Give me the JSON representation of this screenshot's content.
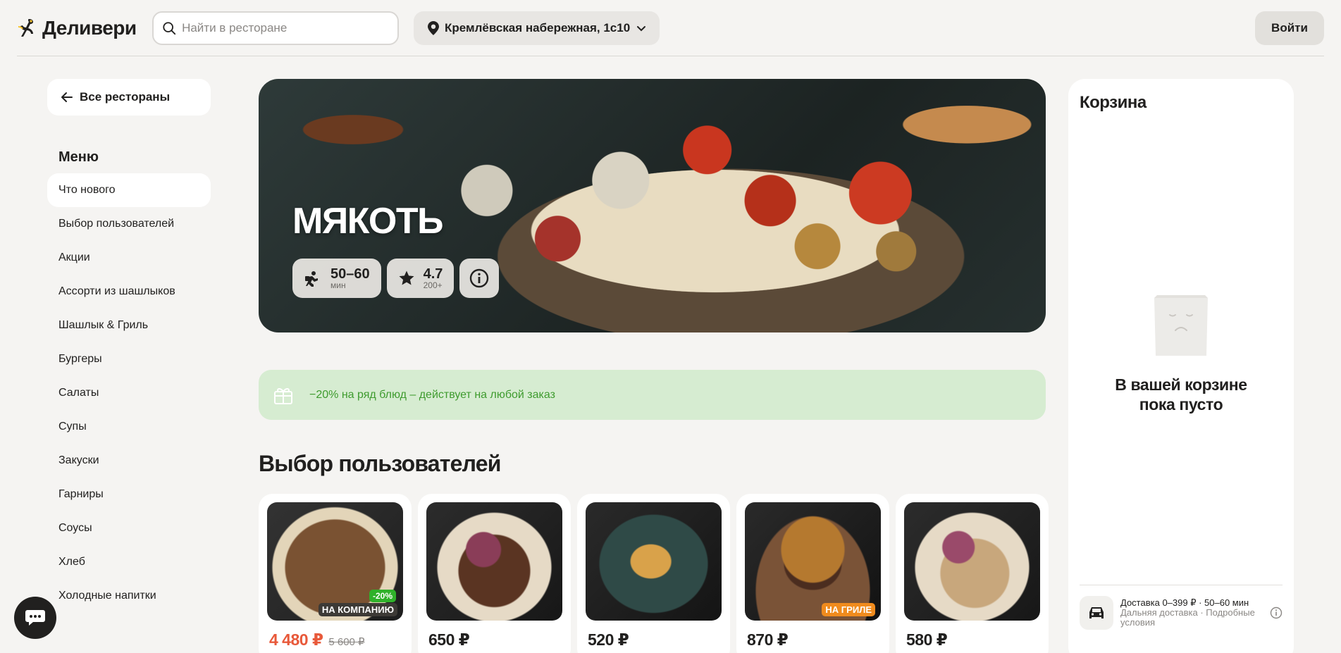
{
  "header": {
    "logo_text": "Деливери",
    "search_placeholder": "Найти в ресторане",
    "address": "Кремлёвская набережная, 1с10",
    "login_label": "Войти"
  },
  "sidebar": {
    "back_label": "Все рестораны",
    "menu_title": "Меню",
    "items": [
      {
        "label": "Что нового",
        "active": true
      },
      {
        "label": "Выбор пользователей"
      },
      {
        "label": "Акции"
      },
      {
        "label": "Ассорти из шашлыков"
      },
      {
        "label": "Шашлык & Гриль"
      },
      {
        "label": "Бургеры"
      },
      {
        "label": "Салаты"
      },
      {
        "label": "Супы"
      },
      {
        "label": "Закуски"
      },
      {
        "label": "Гарниры"
      },
      {
        "label": "Соусы"
      },
      {
        "label": "Хлеб"
      },
      {
        "label": "Холодные напитки"
      }
    ]
  },
  "restaurant": {
    "name": "МЯКОТЬ",
    "delivery_time": "50–60",
    "delivery_unit": "мин",
    "rating": "4.7",
    "rating_count": "200+"
  },
  "promo": {
    "text": "−20% на ряд блюд – действует на любой заказ"
  },
  "section": {
    "title": "Выбор пользователей"
  },
  "products": [
    {
      "price": "4 480 ₽",
      "old_price": "5 600 ₽",
      "discount_badge": "-20%",
      "tag": "НА КОМПАНИЮ"
    },
    {
      "price": "650 ₽"
    },
    {
      "price": "520 ₽"
    },
    {
      "price": "870 ₽",
      "tag": "НА ГРИЛЕ"
    },
    {
      "price": "580 ₽"
    }
  ],
  "cart": {
    "title": "Корзина",
    "empty_line1": "В вашей корзине",
    "empty_line2": "пока пусто",
    "delivery_main": "Доставка 0–399 ₽ · 50–60 мин",
    "delivery_sub": "Дальняя доставка · Подробные условия"
  },
  "colors": {
    "background": "#f5f4f2",
    "promo_bg": "#d6ecd1",
    "promo_text": "#3e9b2e",
    "sale_price": "#e8593a",
    "discount_badge": "#2fb12a",
    "grill_badge": "#f08b1d"
  }
}
